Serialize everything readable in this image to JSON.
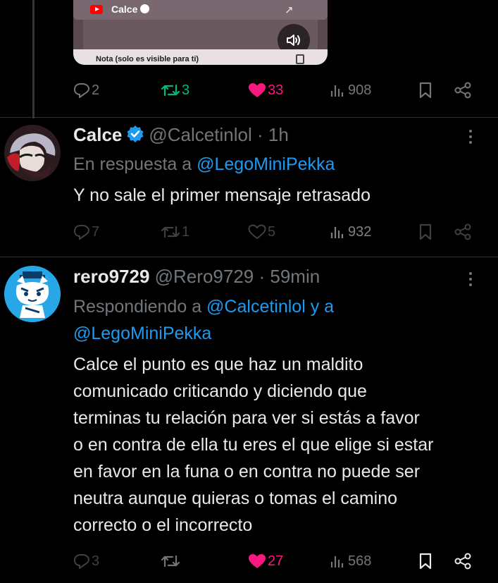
{
  "top_card": {
    "channel_name": "Calce",
    "note": "Nota (solo es visible para ti)"
  },
  "top_actions": {
    "replies": "2",
    "retweets": "3",
    "likes": "33",
    "views": "908"
  },
  "tweet1": {
    "name": "Calce",
    "handle": "@Calcetinlol",
    "separator": "·",
    "time": "1h",
    "reply_prefix": "En respuesta a ",
    "reply_mention": "@LegoMiniPekka",
    "text": "Y no sale el primer mensaje retrasado",
    "actions": {
      "replies": "7",
      "retweets": "1",
      "likes": "5",
      "views": "932"
    }
  },
  "tweet2": {
    "name": "rero9729",
    "handle": "@Rero9729",
    "separator": "·",
    "time": "59min",
    "reply_prefix": "Respondiendo a ",
    "reply_mention1": "@Calcetinlol y a",
    "reply_mention2": "@LegoMiniPekka",
    "text_lines": [
      "Calce el punto es que haz un maldito",
      "comunicado criticando y diciendo que",
      "terminas tu relación para ver si estás a favor",
      "o en contra de ella tu eres el que elige si estar",
      "en favor en la funa o en contra no puede ser",
      "neutra aunque quieras o tomas el camino",
      "correcto o el incorrecto"
    ],
    "actions": {
      "replies": "3",
      "likes": "27",
      "views": "568"
    }
  },
  "colors": {
    "accent_blue": "#1d9bf0",
    "like_pink": "#f91880",
    "retweet_green": "#00ba7c",
    "muted_gray": "#71767b"
  }
}
